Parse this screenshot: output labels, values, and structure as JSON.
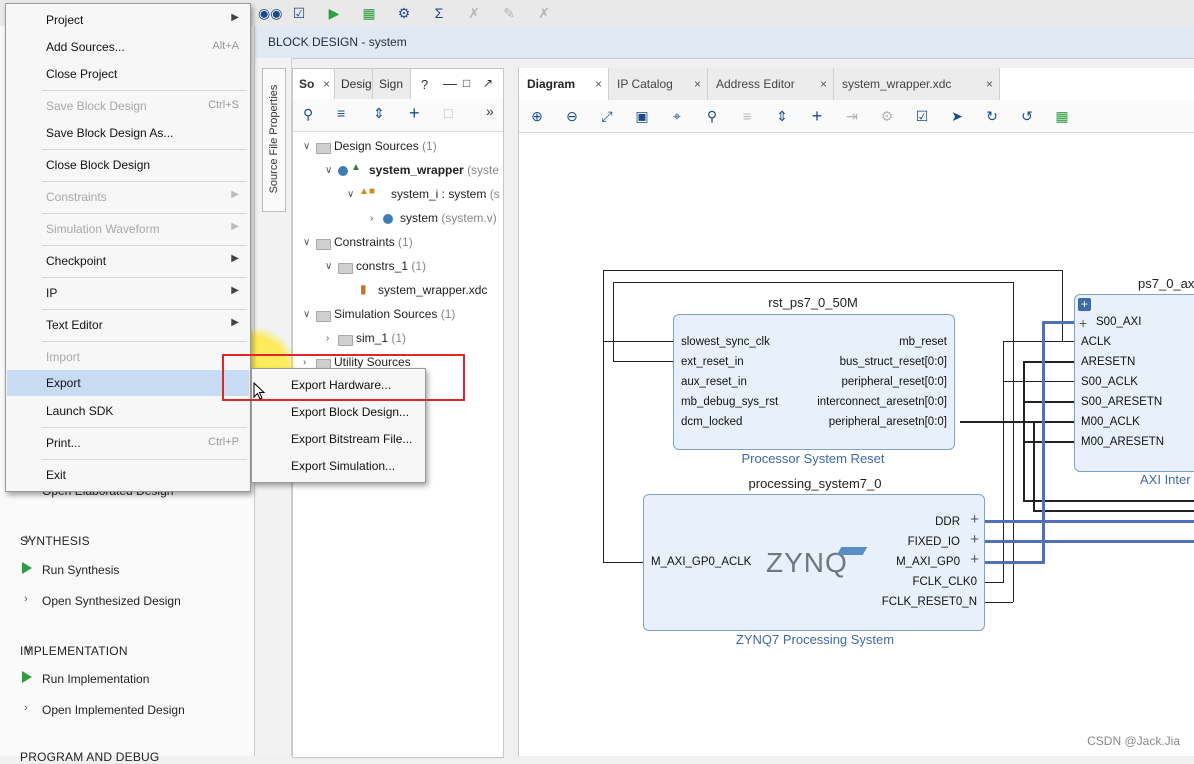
{
  "window": {
    "panel_title": "BLOCK DESIGN",
    "panel_subtitle": "- system"
  },
  "flow_navigator": {
    "partial_item": "Open Elaborated Design",
    "synthesis": {
      "header": "SYNTHESIS",
      "run": "Run Synthesis",
      "open": "Open Synthesized Design"
    },
    "implementation": {
      "header": "IMPLEMENTATION",
      "run": "Run Implementation",
      "open": "Open Implemented Design"
    },
    "program_debug_header": "PROGRAM AND DEBUG"
  },
  "file_menu": {
    "items": [
      {
        "label": "Project",
        "submenu": true,
        "enabled": true
      },
      {
        "label": "Add Sources...",
        "shortcut": "Alt+A",
        "enabled": true
      },
      {
        "label": "Close Project",
        "enabled": true
      },
      {
        "label": "Save Block Design",
        "shortcut": "Ctrl+S",
        "enabled": false
      },
      {
        "label": "Save Block Design As...",
        "enabled": true
      },
      {
        "label": "Close Block Design",
        "enabled": true
      },
      {
        "label": "Constraints",
        "submenu": true,
        "enabled": false
      },
      {
        "label": "Simulation Waveform",
        "submenu": true,
        "enabled": false
      },
      {
        "label": "Checkpoint",
        "submenu": true,
        "enabled": true
      },
      {
        "label": "IP",
        "submenu": true,
        "enabled": true
      },
      {
        "label": "Text Editor",
        "submenu": true,
        "enabled": true
      },
      {
        "label": "Import",
        "submenu": true,
        "enabled": false
      },
      {
        "label": "Export",
        "submenu": true,
        "enabled": true
      },
      {
        "label": "Launch SDK",
        "enabled": true
      },
      {
        "label": "Print...",
        "shortcut": "Ctrl+P",
        "enabled": true
      },
      {
        "label": "Exit",
        "enabled": true
      }
    ]
  },
  "export_submenu": {
    "items": [
      "Export Hardware...",
      "Export Block Design...",
      "Export Bitstream File...",
      "Export Simulation..."
    ]
  },
  "source_file_properties_tab": "Source File Properties",
  "sources_panel": {
    "tabs": [
      "So",
      "Desig",
      "Sign"
    ],
    "tree": {
      "design_sources": {
        "label": "Design Sources",
        "count": "(1)"
      },
      "system_wrapper": {
        "label": "system_wrapper",
        "suffix": "(syste"
      },
      "system_i": {
        "label": "system_i : system",
        "suffix": "(s"
      },
      "system": {
        "label": "system",
        "suffix": "(system.v)"
      },
      "constraints": {
        "label": "Constraints",
        "count": "(1)"
      },
      "constrs_1": {
        "label": "constrs_1",
        "count": "(1)"
      },
      "xdc": {
        "label": "system_wrapper.xdc"
      },
      "simulation_sources": {
        "label": "Simulation Sources",
        "count": "(1)"
      },
      "sim_1": {
        "label": "sim_1",
        "count": "(1)"
      },
      "utility_sources": {
        "label": "Utility Sources"
      }
    }
  },
  "diagram_panel": {
    "tabs": [
      {
        "label": "Diagram",
        "active": true
      },
      {
        "label": "IP Catalog"
      },
      {
        "label": "Address Editor"
      },
      {
        "label": "system_wrapper.xdc"
      }
    ]
  },
  "blocks": {
    "rst": {
      "instance": "rst_ps7_0_50M",
      "type_name": "Processor System Reset",
      "inputs": [
        "slowest_sync_clk",
        "ext_reset_in",
        "aux_reset_in",
        "mb_debug_sys_rst",
        "dcm_locked"
      ],
      "outputs": [
        "mb_reset",
        "bus_struct_reset[0:0]",
        "peripheral_reset[0:0]",
        "interconnect_aresetn[0:0]",
        "peripheral_aresetn[0:0]"
      ]
    },
    "ps7": {
      "instance": "processing_system7_0",
      "type_name": "ZYNQ7 Processing System",
      "logo": "ZYNQ",
      "inputs": [
        "M_AXI_GP0_ACLK"
      ],
      "outputs": [
        "DDR",
        "FIXED_IO",
        "M_AXI_GP0",
        "FCLK_CLK0",
        "FCLK_RESET0_N"
      ]
    },
    "axi": {
      "instance": "ps7_0_ax",
      "type_name": "AXI Inter",
      "inputs": [
        "S00_AXI",
        "ACLK",
        "ARESETN",
        "S00_ACLK",
        "S00_ARESETN",
        "M00_ACLK",
        "M00_ARESETN"
      ]
    }
  },
  "watermark": "CSDN @Jack.Jia"
}
